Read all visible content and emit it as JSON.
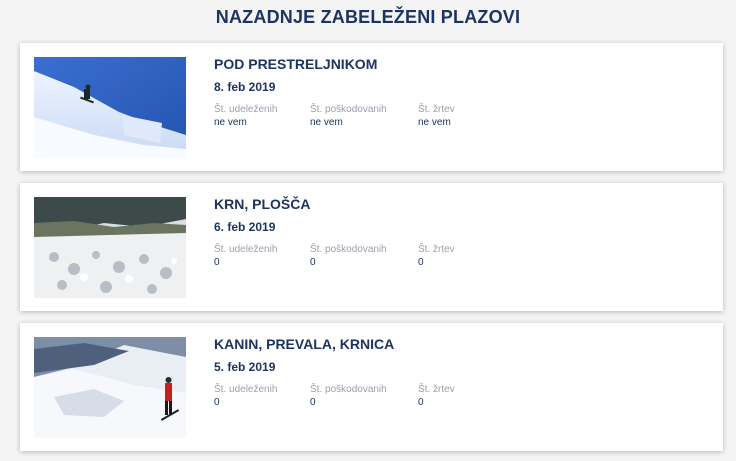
{
  "page": {
    "title": "NAZADNJE ZABELEŽENI PLAZOVI"
  },
  "stat_labels": {
    "participants": "Št. udeleženih",
    "injured": "Št. poškodovanih",
    "victims": "Št. žrtev"
  },
  "avalanches": [
    {
      "title": "POD PRESTRELJNIKOM",
      "date": "8. feb 2019",
      "participants": "ne vem",
      "injured": "ne vem",
      "victims": "ne vem"
    },
    {
      "title": "KRN, PLOŠČA",
      "date": "6. feb 2019",
      "participants": "0",
      "injured": "0",
      "victims": "0"
    },
    {
      "title": "KANIN, PREVALA, KRNICA",
      "date": "5. feb 2019",
      "participants": "0",
      "injured": "0",
      "victims": "0"
    }
  ]
}
